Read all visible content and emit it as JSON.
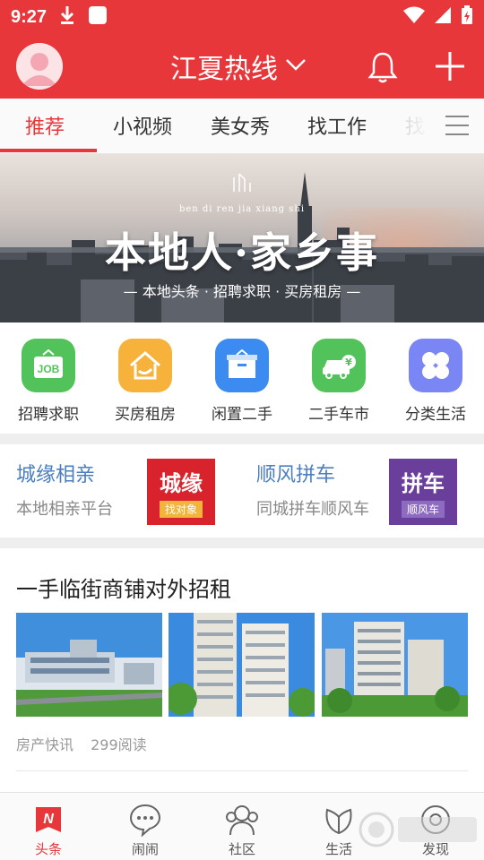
{
  "status_bar": {
    "time": "9:27",
    "icons": [
      "download-icon",
      "app-icon",
      "wifi-icon",
      "signal-icon",
      "battery-icon"
    ]
  },
  "header": {
    "title": "江夏热线",
    "icons": [
      "avatar",
      "chevron-down-icon",
      "bell-icon",
      "plus-icon"
    ]
  },
  "tabs": {
    "items": [
      "推荐",
      "小视频",
      "美女秀",
      "找工作",
      "找"
    ],
    "active_index": 0
  },
  "banner": {
    "pinyin": "ben di ren jia xiang shi",
    "title": "本地人·家乡事",
    "subtitle": "— 本地头条 · 招聘求职 · 买房租房 —"
  },
  "quick_links": [
    {
      "label": "招聘求职",
      "icon": "job-icon",
      "color": "#52c25a"
    },
    {
      "label": "买房租房",
      "icon": "house-icon",
      "color": "#f6b23a"
    },
    {
      "label": "闲置二手",
      "icon": "box-icon",
      "color": "#3b8bf0"
    },
    {
      "label": "二手车市",
      "icon": "car-icon",
      "color": "#52c25a"
    },
    {
      "label": "分类生活",
      "icon": "clover-icon",
      "color": "#7b86f5"
    }
  ],
  "promos": [
    {
      "title": "城缘相亲",
      "subtitle": "本地相亲平台",
      "img_big": "城缘",
      "img_small": "找对象",
      "img_color": "#d9232c"
    },
    {
      "title": "顺风拼车",
      "subtitle": "同城拼车顺风车",
      "img_big": "拼车",
      "img_small": "顺风车",
      "img_color": "#6a3f9b"
    }
  ],
  "article": {
    "title": "一手临街商铺对外招租",
    "source": "房产快讯",
    "reads": "299阅读"
  },
  "bottom_nav": {
    "items": [
      {
        "label": "头条",
        "icon": "news-icon"
      },
      {
        "label": "闹闹",
        "icon": "chat-icon"
      },
      {
        "label": "社区",
        "icon": "community-icon"
      },
      {
        "label": "生活",
        "icon": "life-icon"
      },
      {
        "label": "发现",
        "icon": "discover-icon"
      }
    ],
    "active_index": 0
  },
  "colors": {
    "brand": "#e8373b",
    "link_blue": "#4a7ec0"
  }
}
